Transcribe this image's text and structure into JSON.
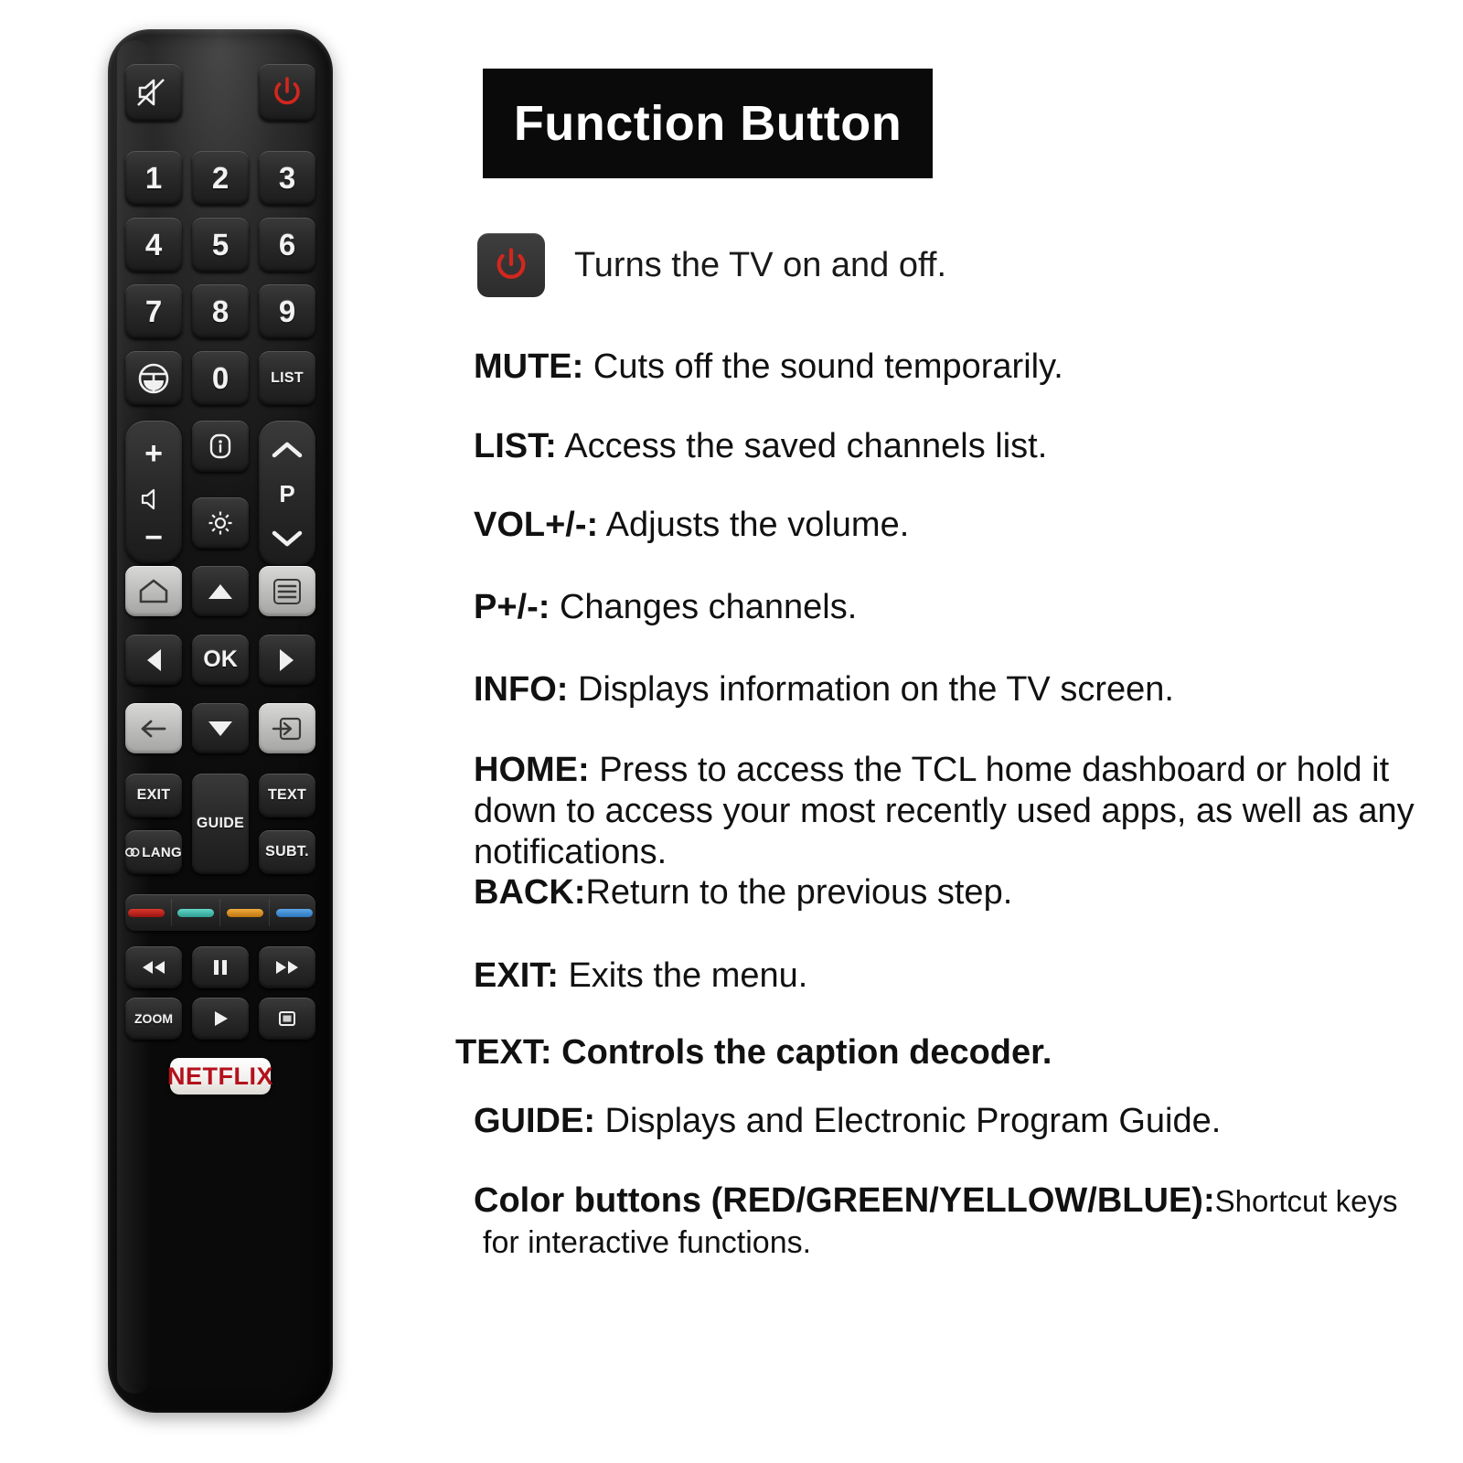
{
  "header": {
    "title": "Function Button"
  },
  "remote": {
    "brand_button": "NETFLIX",
    "top_row": [
      {
        "name": "mute-button",
        "label": "",
        "icon": "mute-icon"
      },
      {
        "name": "power-button",
        "label": "",
        "icon": "power-icon"
      }
    ],
    "keypad": [
      "1",
      "2",
      "3",
      "4",
      "5",
      "6",
      "7",
      "8",
      "9"
    ],
    "row_zero": [
      {
        "name": "teletext-button",
        "label": "",
        "icon": "teletext-icon"
      },
      {
        "name": "zero-button",
        "label": "0"
      },
      {
        "name": "list-button",
        "label": "LIST"
      }
    ],
    "volume_rocker": {
      "plus": "+",
      "minus": "−",
      "icon": "volume-icon"
    },
    "info_button": {
      "label": "",
      "icon": "info-icon"
    },
    "settings_button": {
      "label": "",
      "icon": "gear-icon"
    },
    "channel_rocker": {
      "up": "∧",
      "label": "P",
      "down": "∨"
    },
    "nav": {
      "home": {
        "label": "",
        "icon": "home-icon"
      },
      "menu": {
        "label": "",
        "icon": "menu-icon"
      },
      "up": "▲",
      "down": "▼",
      "left": "◀",
      "right": "▶",
      "ok": "OK",
      "back": {
        "label": "",
        "icon": "back-arrow-icon"
      },
      "source": {
        "label": "",
        "icon": "source-input-icon"
      }
    },
    "fn_block": {
      "exit": "EXIT",
      "guide": "GUIDE",
      "text": "TEXT",
      "lang": "LANG",
      "subt": "SUBT."
    },
    "color_buttons": [
      {
        "name": "red-color-button",
        "color": "#c0201a"
      },
      {
        "name": "green-color-button",
        "color": "#3fbfb0"
      },
      {
        "name": "yellow-color-button",
        "color": "#d89020"
      },
      {
        "name": "blue-color-button",
        "color": "#3d8fd8"
      }
    ],
    "media": {
      "rewind": "◀◀",
      "pause": "Ⅱ",
      "forward": "▶▶",
      "zoom": "ZOOM",
      "play": "▶",
      "stop": "■"
    }
  },
  "descriptions": {
    "power": {
      "label": "",
      "desc": "Turns the TV on and off."
    },
    "mute": {
      "label": "MUTE:",
      "desc": " Cuts off the sound temporarily."
    },
    "list": {
      "label": "LIST:",
      "desc": " Access the saved channels list."
    },
    "vol": {
      "label": "VOL+/-:",
      "desc": " Adjusts the volume."
    },
    "p": {
      "label": "P+/-:",
      "desc": " Changes channels."
    },
    "info": {
      "label": "INFO:",
      "desc": " Displays information on the TV screen."
    },
    "home": {
      "label": "HOME:",
      "desc": " Press to access the TCL home dashboard or hold it down to access your most recently used apps, as well as any notifications."
    },
    "back": {
      "label": "BACK:",
      "desc": "Return to the previous step."
    },
    "exit": {
      "label": "EXIT:",
      "desc": " Exits the menu."
    },
    "text": {
      "label": "TEXT:",
      "desc": " Controls the caption decoder."
    },
    "guide": {
      "label": "GUIDE:",
      "desc": " Displays and Electronic Program Guide."
    },
    "color": {
      "label": "Color buttons (RED/GREEN/YELLOW/BLUE):",
      "desc": "Shortcut keys",
      "desc2": "for interactive functions."
    }
  },
  "colors": {
    "power_red": "#d2271e",
    "netflix_red": "#b3121c",
    "title_bg": "#0a0a0a"
  }
}
